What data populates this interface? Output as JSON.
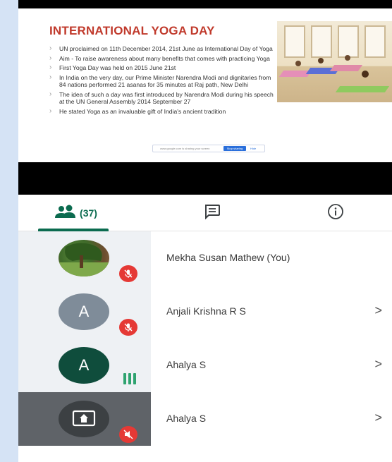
{
  "slide": {
    "title": "INTERNATIONAL YOGA DAY",
    "bullets": [
      "UN proclaimed on 11th December 2014, 21st June as International Day of Yoga",
      "Aim - To  raise awareness about many benefits that comes with practicing Yoga",
      "First Yoga Day was held on 2015 June 21st",
      "In India on the very day, our Prime Minister Narendra Modi and dignitaries from 84 nations performed 21 asanas for 35 minutes at Raj path, New Delhi",
      "The idea of such a day was first introduced by Narendra Modi during his speech at the UN General Assembly 2014 September 27",
      "He stated Yoga as an invaluable gift of India's ancient tradition"
    ],
    "share_bar": {
      "text": "www.google.com is sharing your screen",
      "stop_label": "Stop sharing",
      "hide_label": "Hide"
    }
  },
  "tabs": {
    "people_count": "(37)",
    "people_icon": "people-icon",
    "chat_icon": "chat-icon",
    "info_icon": "info-icon"
  },
  "participants": [
    {
      "name": "Mekha Susan Mathew (You)",
      "avatar": "photo",
      "status": "muted",
      "chevron": ""
    },
    {
      "name": "Anjali Krishna R S",
      "avatar": "A",
      "avatar_color": "#7f8c99",
      "status": "muted",
      "chevron": ">"
    },
    {
      "name": "Ahalya S",
      "avatar": "A",
      "avatar_color": "#0f4d3c",
      "status": "speaking",
      "chevron": ">"
    },
    {
      "name": "Ahalya S",
      "avatar": "presenting",
      "status": "muted",
      "chevron": ">"
    }
  ],
  "colors": {
    "accent": "#0b6b4f",
    "mute": "#e53935",
    "speaking": "#2ea36f",
    "title_red": "#c0392b"
  }
}
